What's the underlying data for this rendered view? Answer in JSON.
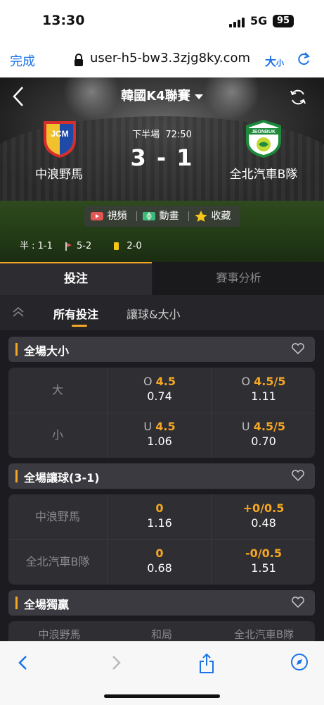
{
  "status_bar": {
    "time": "13:30",
    "network": "5G",
    "battery": "95"
  },
  "browser": {
    "done_label": "完成",
    "url": "user-h5-bw3.3zjg8ky.com",
    "text_size_label": "大",
    "text_size_small": "小"
  },
  "match": {
    "league": "韓國K4聯賽",
    "period": "下半場",
    "clock": "72:50",
    "score": "3 - 1",
    "home_team": "中浪野馬",
    "away_team": "全北汽車B隊",
    "home_logo_text": "JCM",
    "away_logo_text": "JEONBUK",
    "media": {
      "video": "視頻",
      "animation": "動畫",
      "favorite": "收藏"
    },
    "stats": {
      "half": "半 : 1-1",
      "corners": "5-2",
      "yellow": "2-0"
    }
  },
  "tabs": {
    "bet": "投注",
    "analysis": "賽事分析"
  },
  "filters": {
    "all": "所有投注",
    "handicap_ou": "讓球&大小"
  },
  "sections": {
    "over_under": {
      "title": "全場大小",
      "rows": [
        {
          "label": "大",
          "cells": [
            {
              "prefix": "O",
              "line": "4.5",
              "odds": "0.74"
            },
            {
              "prefix": "O",
              "line": "4.5/5",
              "odds": "1.11"
            }
          ]
        },
        {
          "label": "小",
          "cells": [
            {
              "prefix": "U",
              "line": "4.5",
              "odds": "1.06"
            },
            {
              "prefix": "U",
              "line": "4.5/5",
              "odds": "0.70"
            }
          ]
        }
      ]
    },
    "handicap": {
      "title": "全場讓球(3-1)",
      "rows": [
        {
          "label": "中浪野馬",
          "cells": [
            {
              "prefix": "",
              "line": "0",
              "odds": "1.16"
            },
            {
              "prefix": "",
              "line": "+0/0.5",
              "odds": "0.48"
            }
          ]
        },
        {
          "label": "全北汽車B隊",
          "cells": [
            {
              "prefix": "",
              "line": "0",
              "odds": "0.68"
            },
            {
              "prefix": "",
              "line": "-0/0.5",
              "odds": "1.51"
            }
          ]
        }
      ]
    },
    "moneyline": {
      "title": "全場獨贏",
      "columns": [
        "中浪野馬",
        "和局",
        "全北汽車B隊"
      ]
    }
  },
  "colors": {
    "accent": "#f5a623",
    "browser_blue": "#1a73e8"
  }
}
